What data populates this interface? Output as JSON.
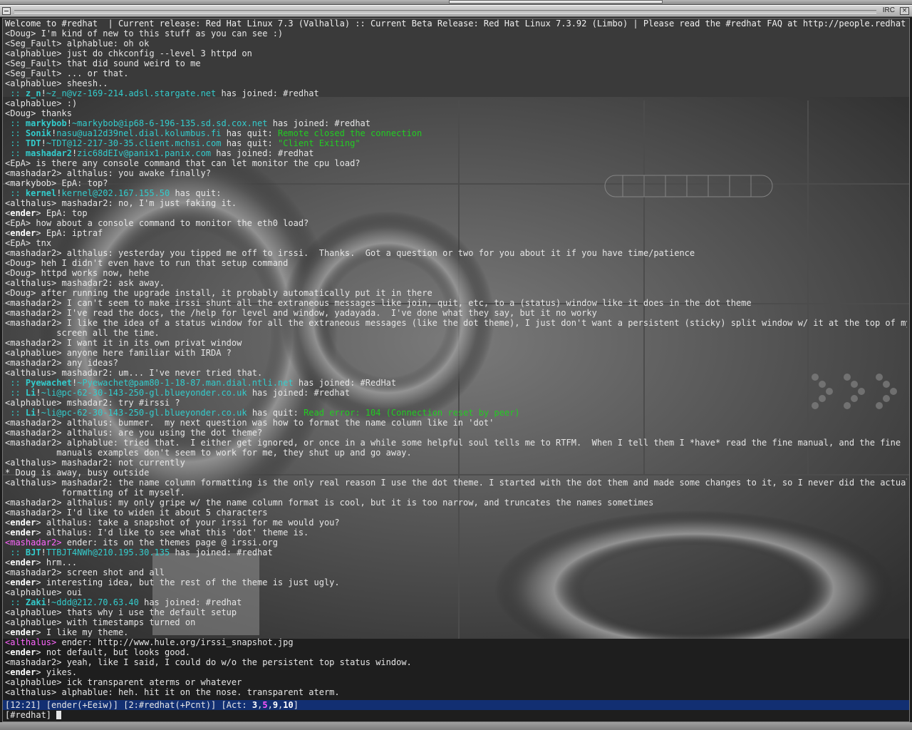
{
  "window": {
    "title": "IRC",
    "close_glyph": "×"
  },
  "topic": "Welcome to #redhat  | Current release: Red Hat Linux 7.3 (Valhalla) :: Current Beta Release: Red Hat Linux 7.3.92 (Limbo) | Please read the #redhat FAQ at http://people.redhat.com",
  "lines": [
    {
      "t": "msg",
      "nick": "Doug",
      "text": "I'm kind of new to this stuff as you can see :)"
    },
    {
      "t": "msg",
      "nick": "Seg_Fault",
      "text": "alphablue: oh ok"
    },
    {
      "t": "msg",
      "nick": "alphablue",
      "text": "just do chkconfig --level 3 httpd on"
    },
    {
      "t": "msg",
      "nick": "Seg_Fault",
      "text": "that did sound weird to me"
    },
    {
      "t": "msg",
      "nick": "Seg_Fault",
      "text": "... or that."
    },
    {
      "t": "msg",
      "nick": "alphablue",
      "text": "sheesh.."
    },
    {
      "t": "join",
      "who": "z_n",
      "host": "~z_n@vz-169-214.adsl.stargate.net",
      "action": "has joined: #redhat"
    },
    {
      "t": "msg",
      "nick": "alphablue",
      "text": ":)"
    },
    {
      "t": "msg",
      "nick": "Doug",
      "text": "thanks"
    },
    {
      "t": "join",
      "who": "markybob",
      "host": "~markybob@ip68-6-196-135.sd.sd.cox.net",
      "action": "has joined: #redhat"
    },
    {
      "t": "quit",
      "who": "Sonik",
      "host": "nasu@ua12d39nel.dial.kolumbus.fi",
      "action": "has quit:",
      "reason": "Remote closed the connection"
    },
    {
      "t": "quit",
      "who": "TDT",
      "host": "~TDT@12-217-30-35.client.mchsi.com",
      "action": "has quit:",
      "reason": "\"Client Exiting\""
    },
    {
      "t": "join",
      "who": "mashadar2",
      "host": "zic68dEIv@panix1.panix.com",
      "action": "has joined: #redhat"
    },
    {
      "t": "msg",
      "nick": "EpA",
      "text": "is there any console command that can let monitor the cpu load?"
    },
    {
      "t": "msg",
      "nick": "mashadar2",
      "text": "althalus: you awake finally?"
    },
    {
      "t": "msg",
      "nick": "markybob",
      "text": "EpA: top?"
    },
    {
      "t": "quit",
      "who": "kernel",
      "host": "kernel@202.167.155.50",
      "action": "has quit:",
      "reason": ""
    },
    {
      "t": "msg",
      "nick": "althalus",
      "text": "mashadar2: no, I'm just faking it."
    },
    {
      "t": "msg",
      "nick": "ender",
      "bold": true,
      "text": "EpA: top"
    },
    {
      "t": "msg",
      "nick": "EpA",
      "text": "how about a console command to monitor the eth0 load?"
    },
    {
      "t": "msg",
      "nick": "ender",
      "bold": true,
      "text": "EpA: iptraf"
    },
    {
      "t": "msg",
      "nick": "EpA",
      "text": "tnx"
    },
    {
      "t": "msg",
      "nick": "mashadar2",
      "text": "althalus: yesterday you tipped me off to irssi.  Thanks.  Got a question or two for you about it if you have time/patience"
    },
    {
      "t": "msg",
      "nick": "Doug",
      "text": "heh I didn't even have to run that setup command"
    },
    {
      "t": "msg",
      "nick": "Doug",
      "text": "httpd works now, hehe"
    },
    {
      "t": "msg",
      "nick": "althalus",
      "text": "mashadar2: ask away."
    },
    {
      "t": "msg",
      "nick": "Doug",
      "text": "after running the upgrade install, it probably automatically put it in there"
    },
    {
      "t": "msg",
      "nick": "mashadar2",
      "text": "I can't seem to make irssi shunt all the extraneous messages like join, quit, etc, to a (status) window like it does in the dot theme"
    },
    {
      "t": "msg",
      "nick": "mashadar2",
      "text": "I've read the docs, the /help for level and window, yadayada.  I've done what they say, but it no worky"
    },
    {
      "t": "msg",
      "nick": "mashadar2",
      "text": "I like the idea of a status window for all the extraneous messages (like the dot theme), I just don't want a persistent (sticky) split window w/ it at the top of my"
    },
    {
      "t": "cont",
      "text": "screen all the time."
    },
    {
      "t": "msg",
      "nick": "mashadar2",
      "text": "I want it in its own privat window"
    },
    {
      "t": "msg",
      "nick": "alphablue",
      "text": "anyone here familiar with IRDA ?"
    },
    {
      "t": "msg",
      "nick": "mashadar2",
      "text": "any ideas?"
    },
    {
      "t": "msg",
      "nick": "althalus",
      "text": "mashadar2: um... I've never tried that."
    },
    {
      "t": "join",
      "who": "Pyewachet",
      "host": "~Pyewachet@pam80-1-18-87.man.dial.ntli.net",
      "action": "has joined: #RedHat"
    },
    {
      "t": "join",
      "who": "Li",
      "host": "~li@pc-62-30-143-250-gl.blueyonder.co.uk",
      "action": "has joined: #redhat"
    },
    {
      "t": "msg",
      "nick": "alphablue",
      "text": "mshadar2: try #irssi ?"
    },
    {
      "t": "quit",
      "who": "Li",
      "host": "~li@pc-62-30-143-250-gl.blueyonder.co.uk",
      "action": "has quit:",
      "reason": "Read error: 104 (Connection reset by peer)"
    },
    {
      "t": "msg",
      "nick": "mashadar2",
      "text": "althalus: bummer.  my next question was how to format the name column like in 'dot'"
    },
    {
      "t": "msg",
      "nick": "mashadar2",
      "text": "althalus: are you using the dot theme?"
    },
    {
      "t": "msg",
      "nick": "mashadar2",
      "text": "alphablue: tried that.  I either get ignored, or once in a while some helpful soul tells me to RTFM.  When I tell them I *have* read the fine manual, and the fine"
    },
    {
      "t": "cont",
      "text": "manuals examples don't seem to work for me, they shut up and go away."
    },
    {
      "t": "msg",
      "nick": "althalus",
      "text": "mashadar2: not currently"
    },
    {
      "t": "action",
      "text": "* Doug is away, busy outside"
    },
    {
      "t": "msg",
      "nick": "althalus",
      "text": "mashadar2: the name column formatting is the only real reason I use the dot theme. I started with the dot them and made some changes to it, so I never did the actual"
    },
    {
      "t": "cont",
      "indent": "wide",
      "text": "formatting of it myself."
    },
    {
      "t": "msg",
      "nick": "mashadar2",
      "text": "althalus: my only gripe w/ the name column format is cool, but it is too narrow, and truncates the names sometimes"
    },
    {
      "t": "msg",
      "nick": "mashadar2",
      "text": "I'd like to widen it about 5 characters"
    },
    {
      "t": "msg",
      "nick": "ender",
      "bold": true,
      "text": "althalus: take a snapshot of your irssi for me would you?"
    },
    {
      "t": "msg",
      "nick": "ender",
      "bold": true,
      "text": "althalus: I'd like to see what this 'dot' theme is."
    },
    {
      "t": "msg",
      "nick": "mashadar2",
      "hl": true,
      "text": "ender: its on the themes page @ irssi.org"
    },
    {
      "t": "join",
      "who": "BJT",
      "host": "TTBJT4NWh@210.195.30.135",
      "action": "has joined: #redhat"
    },
    {
      "t": "msg",
      "nick": "ender",
      "bold": true,
      "text": "hrm..."
    },
    {
      "t": "msg",
      "nick": "mashadar2",
      "text": "screen shot and all"
    },
    {
      "t": "msg",
      "nick": "ender",
      "bold": true,
      "text": "interesting idea, but the rest of the theme is just ugly."
    },
    {
      "t": "msg",
      "nick": "alphablue",
      "text": "oui"
    },
    {
      "t": "join",
      "who": "Zaki",
      "host": "~ddd@212.70.63.40",
      "action": "has joined: #redhat"
    },
    {
      "t": "msg",
      "nick": "alphablue",
      "text": "thats why i use the default setup"
    },
    {
      "t": "msg",
      "nick": "alphablue",
      "text": "with timestamps turned on"
    },
    {
      "t": "msg",
      "nick": "ender",
      "bold": true,
      "text": "I like my theme."
    },
    {
      "t": "msg",
      "nick": "althalus",
      "hl": true,
      "text": "ender: http://www.hule.org/irssi_snapshot.jpg"
    },
    {
      "t": "msg",
      "nick": "ender",
      "bold": true,
      "text": "not default, but looks good."
    },
    {
      "t": "msg",
      "nick": "mashadar2",
      "text": "yeah, like I said, I could do w/o the persistent top status window."
    },
    {
      "t": "msg",
      "nick": "ender",
      "bold": true,
      "text": "yikes."
    },
    {
      "t": "msg",
      "nick": "alphablue",
      "text": "ick transparent aterms or whatever"
    },
    {
      "t": "msg",
      "nick": "althalus",
      "text": "alphablue: heh. hit it on the nose. transparent aterm."
    }
  ],
  "status": {
    "time": "12:21",
    "nick": "ender",
    "umode": "+Eeiw",
    "window": "2:#redhat",
    "cmode": "+Pcnt",
    "act_label": "Act:",
    "act": [
      "3",
      "5",
      "9",
      "10"
    ]
  },
  "input": {
    "prompt": "[#redhat]"
  }
}
